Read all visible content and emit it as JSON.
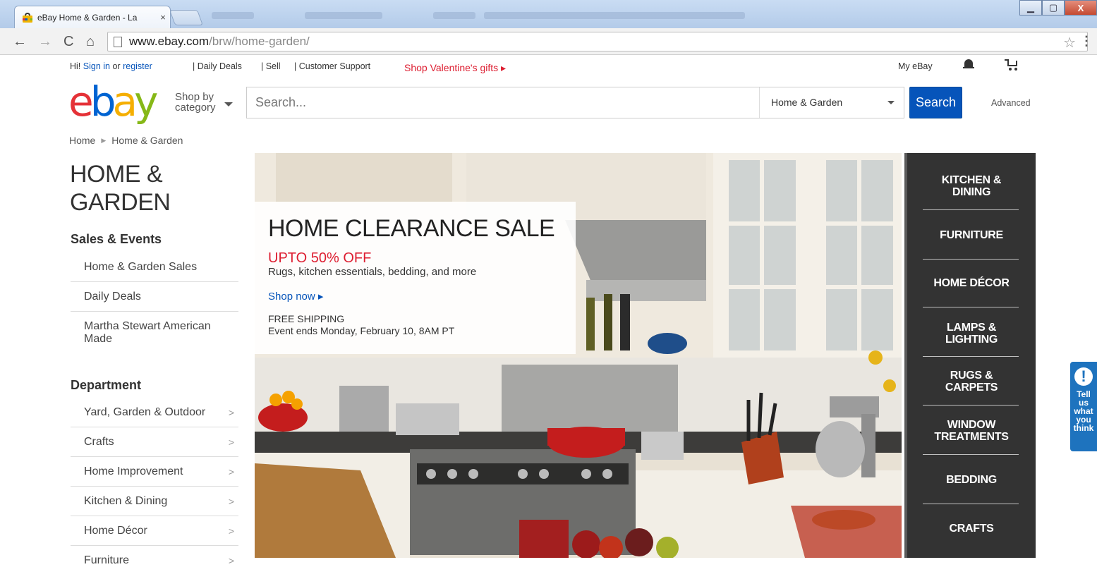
{
  "browser": {
    "tab_title": "eBay Home & Garden - La",
    "tab_close": "×",
    "url_host": "www.ebay.com",
    "url_path": "/brw/home-garden/",
    "win_min": "▁",
    "win_max": "▢",
    "win_close": "X"
  },
  "utility": {
    "greeting": "Hi!",
    "sign_in": "Sign in",
    "or": "or",
    "register": "register",
    "daily_deals": "| Daily Deals",
    "sell": "| Sell",
    "customer_support": "| Customer Support",
    "promo": "Shop Valentine's gifts ▸",
    "my_ebay": "My eBay"
  },
  "logo": {
    "e": "e",
    "b": "b",
    "a": "a",
    "y": "y"
  },
  "shop_by": {
    "line1": "Shop by",
    "line2": "category"
  },
  "search": {
    "placeholder": "Search...",
    "category": "Home & Garden",
    "button": "Search",
    "advanced": "Advanced"
  },
  "breadcrumb": {
    "home": "Home",
    "sep": "▶",
    "current": "Home & Garden"
  },
  "page_title": "HOME & GARDEN",
  "sales_events": {
    "heading": "Sales & Events",
    "items": [
      "Home & Garden Sales",
      "Daily Deals",
      "Martha Stewart American Made"
    ]
  },
  "department": {
    "heading": "Department",
    "chevron": ">",
    "items": [
      "Yard, Garden & Outdoor",
      "Crafts",
      "Home Improvement",
      "Kitchen & Dining",
      "Home Décor",
      "Furniture"
    ]
  },
  "hero": {
    "title": "HOME CLEARANCE SALE",
    "discount": "UPTO 50% OFF",
    "subtitle": "Rugs, kitchen essentials, bedding, and more",
    "link": "Shop now ▸",
    "shipping": "FREE SHIPPING",
    "ends": "Event ends Monday, February 10, 8AM PT"
  },
  "categories": [
    {
      "line1": "KITCHEN &",
      "line2": "DINING"
    },
    {
      "line1": "FURNITURE",
      "line2": ""
    },
    {
      "line1": "HOME DÉCOR",
      "line2": ""
    },
    {
      "line1": "LAMPS &",
      "line2": "LIGHTING"
    },
    {
      "line1": "RUGS &",
      "line2": "CARPETS"
    },
    {
      "line1": "WINDOW",
      "line2": "TREATMENTS"
    },
    {
      "line1": "BEDDING",
      "line2": ""
    },
    {
      "line1": "CRAFTS",
      "line2": ""
    }
  ],
  "feedback": {
    "icon": "!",
    "lines": [
      "Tell",
      "us",
      "what",
      "you",
      "think"
    ]
  },
  "colors": {
    "ebay_red": "#e53238",
    "ebay_blue": "#0064d2",
    "ebay_yellow": "#f5af02",
    "ebay_green": "#86b817",
    "link_blue": "#0654ba",
    "promo_red": "#dd1e31",
    "category_panel": "#333333"
  }
}
